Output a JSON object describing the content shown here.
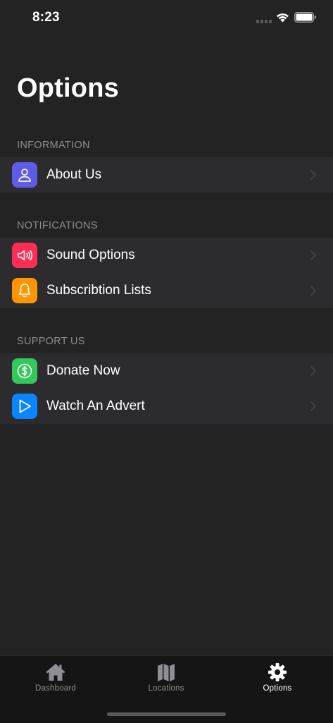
{
  "status_bar": {
    "time": "8:23",
    "icons": [
      "signal-icon",
      "wifi-icon",
      "battery-icon"
    ]
  },
  "page": {
    "title": "Options"
  },
  "sections": [
    {
      "header": "INFORMATION",
      "items": [
        {
          "label": "About Us",
          "icon": "person-icon",
          "color": "#5e5ce6"
        }
      ]
    },
    {
      "header": "NOTIFICATIONS",
      "items": [
        {
          "label": "Sound Options",
          "icon": "speaker-icon",
          "color": "#ff2d55"
        },
        {
          "label": "Subscribtion Lists",
          "icon": "bell-icon",
          "color": "#ff9500"
        }
      ]
    },
    {
      "header": "SUPPORT US",
      "items": [
        {
          "label": "Donate Now",
          "icon": "dollar-icon",
          "color": "#34c759"
        },
        {
          "label": "Watch An Advert",
          "icon": "play-icon",
          "color": "#0a84ff"
        }
      ]
    }
  ],
  "tab_bar": {
    "tabs": [
      {
        "label": "Dashboard",
        "icon": "house-icon",
        "active": false
      },
      {
        "label": "Locations",
        "icon": "map-icon",
        "active": false
      },
      {
        "label": "Options",
        "icon": "gear-icon",
        "active": true
      }
    ],
    "active_color": "#ffffff",
    "inactive_color": "#8e8e93"
  },
  "colors": {
    "background": "#232323",
    "group_background": "#2c2c2e",
    "section_header": "#8d8d92",
    "tab_bar_background": "#151515"
  }
}
